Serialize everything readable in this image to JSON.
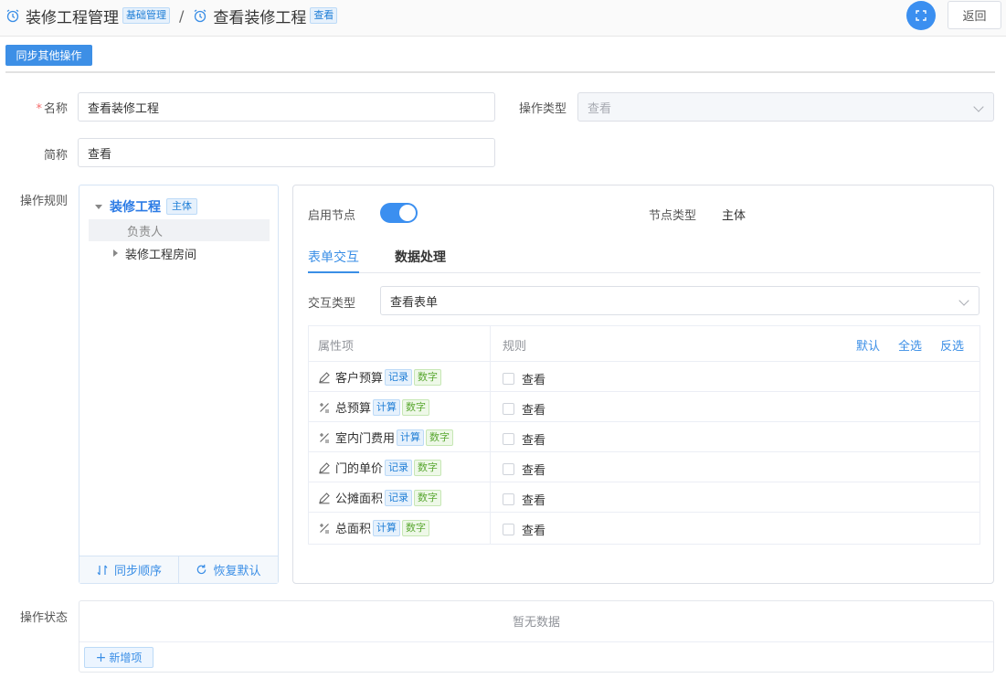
{
  "header": {
    "app_title": "装修工程管理",
    "app_tag": "基础管理",
    "separator": "/",
    "page_title": "查看装修工程",
    "page_tag": "查看",
    "back_label": "返回"
  },
  "toolbar": {
    "sync_label": "同步其他操作"
  },
  "form": {
    "name_label": "名称",
    "name_value": "查看装修工程",
    "optype_label": "操作类型",
    "optype_value": "查看",
    "short_label": "简称",
    "short_value": "查看",
    "rules_label": "操作规则",
    "status_label": "操作状态"
  },
  "tree": {
    "root_label": "装修工程",
    "root_tag": "主体",
    "child1": "负责人",
    "child2": "装修工程房间",
    "sync_order": "同步顺序",
    "restore_default": "恢复默认"
  },
  "node": {
    "enable_label": "启用节点",
    "enabled": true,
    "type_label": "节点类型",
    "type_value": "主体"
  },
  "tabs": [
    "表单交互",
    "数据处理"
  ],
  "interaction": {
    "label": "交互类型",
    "value": "查看表单"
  },
  "table": {
    "col_attr": "属性项",
    "col_rule": "规则",
    "action_default": "默认",
    "action_all": "全选",
    "action_invert": "反选",
    "rows": [
      {
        "name": "客户预算",
        "kind": "记录",
        "type": "数字",
        "icon": "pencil-icon",
        "rule": "查看"
      },
      {
        "name": "总预算",
        "kind": "计算",
        "type": "数字",
        "icon": "formula-icon",
        "rule": "查看"
      },
      {
        "name": "室内门费用",
        "kind": "计算",
        "type": "数字",
        "icon": "formula-icon",
        "rule": "查看"
      },
      {
        "name": "门的单价",
        "kind": "记录",
        "type": "数字",
        "icon": "pencil-icon",
        "rule": "查看"
      },
      {
        "name": "公摊面积",
        "kind": "记录",
        "type": "数字",
        "icon": "pencil-icon",
        "rule": "查看"
      },
      {
        "name": "总面积",
        "kind": "计算",
        "type": "数字",
        "icon": "formula-icon",
        "rule": "查看"
      }
    ]
  },
  "status": {
    "empty_text": "暂无数据",
    "add_label": "新增项"
  },
  "colors": {
    "primary": "#3a8ee6",
    "tag_green": "#5aa832",
    "required": "#f56c6c"
  }
}
